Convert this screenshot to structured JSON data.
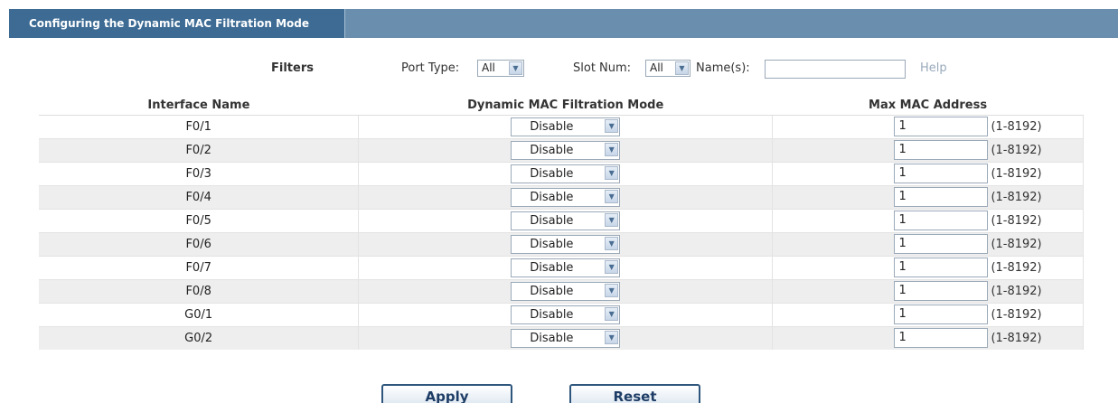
{
  "header": {
    "title": "Configuring the Dynamic MAC Filtration Mode"
  },
  "filters": {
    "title": "Filters",
    "port_type_label": "Port Type:",
    "port_type_value": "All",
    "slot_num_label": "Slot Num:",
    "slot_num_value": "All",
    "names_label": "Name(s):",
    "names_value": "",
    "help_label": "Help"
  },
  "table": {
    "columns": [
      "Interface Name",
      "Dynamic MAC Filtration Mode",
      "Max MAC Address"
    ],
    "rows": [
      {
        "interface": "F0/1",
        "mode": "Disable",
        "max": "1",
        "range": "(1-8192)"
      },
      {
        "interface": "F0/2",
        "mode": "Disable",
        "max": "1",
        "range": "(1-8192)"
      },
      {
        "interface": "F0/3",
        "mode": "Disable",
        "max": "1",
        "range": "(1-8192)"
      },
      {
        "interface": "F0/4",
        "mode": "Disable",
        "max": "1",
        "range": "(1-8192)"
      },
      {
        "interface": "F0/5",
        "mode": "Disable",
        "max": "1",
        "range": "(1-8192)"
      },
      {
        "interface": "F0/6",
        "mode": "Disable",
        "max": "1",
        "range": "(1-8192)"
      },
      {
        "interface": "F0/7",
        "mode": "Disable",
        "max": "1",
        "range": "(1-8192)"
      },
      {
        "interface": "F0/8",
        "mode": "Disable",
        "max": "1",
        "range": "(1-8192)"
      },
      {
        "interface": "G0/1",
        "mode": "Disable",
        "max": "1",
        "range": "(1-8192)"
      },
      {
        "interface": "G0/2",
        "mode": "Disable",
        "max": "1",
        "range": "(1-8192)"
      }
    ]
  },
  "actions": {
    "apply_label": "Apply",
    "reset_label": "Reset"
  },
  "icons": {
    "dropdown": "chevron-down-icon"
  },
  "colors": {
    "title_tab": "#3d6b94",
    "title_bar": "#6a8fae",
    "button_border": "#2f567d"
  }
}
